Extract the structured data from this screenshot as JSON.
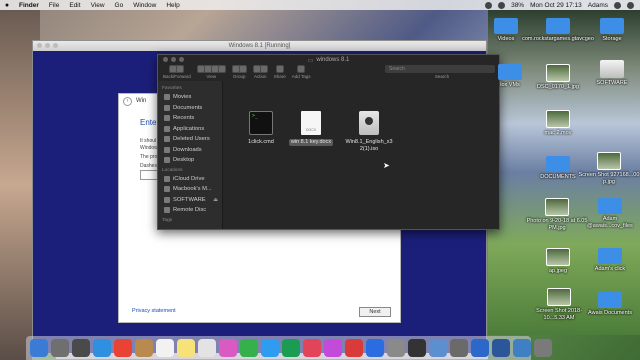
{
  "menubar": {
    "apple": "",
    "items": [
      "Finder",
      "File",
      "Edit",
      "View",
      "Go",
      "Window",
      "Help"
    ],
    "battery": "38%",
    "clock": "Mon Oct 29  17:13",
    "user": "Adams"
  },
  "vm": {
    "title": "Windows 8.1 [Running]",
    "dialog": {
      "title_fragment": "Win",
      "heading": "Enter",
      "line1": "It shoul",
      "line2": "Window",
      "line3": "The pro",
      "line4": "Dashes",
      "privacy": "Privacy statement",
      "next": "Next"
    },
    "progress_fraction": 0.05
  },
  "finder": {
    "title": "windows 8.1",
    "toolbar": {
      "back_forward": "Back/Forward",
      "view": "View",
      "group": "Group",
      "action": "Action",
      "share": "Share",
      "add_tags": "Add Tags",
      "search": "Search",
      "search_placeholder": "Search"
    },
    "sidebar": {
      "favorites_header": "Favorites",
      "favorites": [
        "Movies",
        "Documents",
        "Recents",
        "Applications",
        "Deleted Users",
        "Downloads",
        "Desktop"
      ],
      "locations_header": "Locations",
      "locations": [
        "iCloud Drive",
        "Macbook's M...",
        "SOFTWARE",
        "Remote Disc"
      ],
      "tags_header": "Tags"
    },
    "files": [
      {
        "name": "1click.cmd",
        "icon": "terminal-icon"
      },
      {
        "name": "win 8.1 key.docx",
        "icon": "docx-icon"
      },
      {
        "name": "Win8.1_English_x32(1).iso",
        "line1": "Win8.1_English_x3",
        "line2": "2(1).iso",
        "icon": "iso-icon"
      }
    ]
  },
  "desktop": {
    "icons": [
      "Videos",
      "com.rockstargames.gtavcgeo",
      "Storage",
      "lox VMs",
      "DSC_0170_1.jpg",
      "SOFTWARE",
      "mac 2.mov",
      "DOCUMENTS",
      "Screen Shot 927168...00 p.jpg",
      "Photo on 9-20-18 at 6.05 PM.jpg",
      "Adam @awais...cov_files",
      "ap.jpeg",
      "Adam's click",
      "Screen Shot 2018-10...5.33 AM",
      "Awais Documents"
    ]
  }
}
